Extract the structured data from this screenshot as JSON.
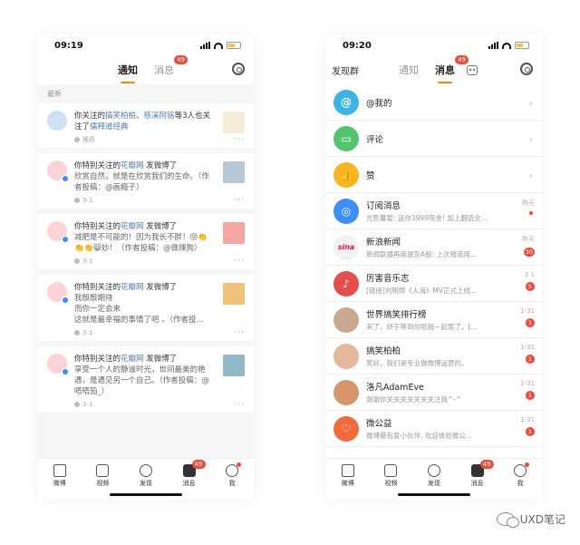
{
  "left": {
    "status_time": "09:19",
    "tabs": [
      {
        "label": "通知",
        "active": true
      },
      {
        "label": "消息",
        "badge": "49"
      }
    ],
    "section_label": "最新",
    "cards": [
      {
        "text_a": "你关注的",
        "link1": "搞笑柏柏",
        "sep": "、",
        "link2": "慈溪阿铭",
        "text_b": "等3人也关注了",
        "link3": "儒释道经典",
        "foot_icon": "person-icon",
        "foot_text": "推荐",
        "avatar_color": "#cfe0f5",
        "thumb_color": "#f3ecd6"
      },
      {
        "text_a": "你特别关注的",
        "link1": "花瓣网",
        "text_b": " 发微博了",
        "sub": "欣赏自然，就是在欣赏我们的生命。（作者投稿：@画瘾子）",
        "foot_text": "3-1",
        "avatar_color": "#fbd3d9",
        "thumb_color": "#b7c9d6"
      },
      {
        "text_a": "你特别关注的",
        "link1": "花瓣网",
        "text_b": " 发微博了",
        "sub": "减肥是不可能的！因为我长不胖！😝👏👏👏😸妙！（作者投稿：@微辣狗）",
        "foot_text": "3-1",
        "avatar_color": "#fbd3d9",
        "thumb_color": "#f4a7a0"
      },
      {
        "text_a": "你特别关注的",
        "link1": "花瓣网",
        "text_b": " 发微博了",
        "sub": "我殷殷期待\n而你一定会来\n这就是最幸福的事情了吧 。（作者投...",
        "foot_text": "3-1",
        "avatar_color": "#fbd3d9",
        "thumb_color": "#f0c27a"
      },
      {
        "text_a": "你特别关注的",
        "link1": "花瓣网",
        "text_b": " 发微博了",
        "sub": "享受一个人的静谧时光，世间最美的艳遇，是遇见另一个自己。（作者投稿：@嗒嗒笳_）",
        "foot_text": "3-1",
        "avatar_color": "#fbd3d9",
        "thumb_color": "#8fb9c9"
      }
    ],
    "tabbar": [
      {
        "label": "微博"
      },
      {
        "label": "视频"
      },
      {
        "label": "发现"
      },
      {
        "label": "消息",
        "badge": "49"
      },
      {
        "label": "我",
        "dot": true
      }
    ]
  },
  "right": {
    "status_time": "09:20",
    "left_link": "发现群",
    "tabs": [
      {
        "label": "通知"
      },
      {
        "label": "消息",
        "active": true,
        "badge": "49"
      }
    ],
    "messages": [
      {
        "title": "@我的",
        "preview": "",
        "time": "",
        "count": "",
        "chevron": true,
        "avatar_color": "#3ab5e6",
        "glyph": "@",
        "icon": "at-icon"
      },
      {
        "title": "评论",
        "preview": "",
        "time": "",
        "count": "",
        "chevron": true,
        "avatar_color": "#53c46c",
        "glyph": "▭",
        "icon": "comment-icon"
      },
      {
        "title": "赞",
        "preview": "",
        "time": "",
        "count": "",
        "chevron": true,
        "avatar_color": "#f8b51d",
        "glyph": "👍",
        "icon": "like-icon"
      },
      {
        "title": "订阅消息",
        "preview": "光影蔓婺: 送你3999现金! 加上翻选全...",
        "time": "昨天",
        "count": "",
        "dot": true,
        "avatar_color": "#3d8ef6",
        "glyph": "◎",
        "icon": "subscribe-icon"
      },
      {
        "title": "新浪新闻",
        "preview": "新闻联播再度提及A股: 上次报道用...",
        "time": "昨天",
        "count": "30",
        "avatar_color": "#f2f2f2",
        "glyph": "sina",
        "icon": "sina-logo"
      },
      {
        "title": "厉害音乐志",
        "preview": "[链接]刘明辉《人海》MV正式上线...",
        "time": "3-1",
        "count": "5",
        "avatar_color": "#e84d4d",
        "glyph": "♪",
        "icon": "music-avatar"
      },
      {
        "title": "世界搞笑排行榜",
        "preview": "来了。终于等到你陪我一起笑了。[...",
        "time": "1-31",
        "count": "1",
        "avatar_color": "#c7a98d",
        "glyph": "",
        "icon": "avatar"
      },
      {
        "title": "搞笑柏柏",
        "preview": "笑好。我们是专业做微博运营的。",
        "time": "1-31",
        "count": "1",
        "avatar_color": "#e4b79a",
        "glyph": "",
        "icon": "avatar"
      },
      {
        "title": "洛凡AdamEve",
        "preview": "谢谢你关关关关关关关注我^-^",
        "time": "1-31",
        "count": "1",
        "avatar_color": "#d7956a",
        "glyph": "",
        "icon": "avatar"
      },
      {
        "title": "微公益",
        "preview": "微博最有爱小伙伴, 欢迎体验微公...",
        "time": "1-31",
        "count": "1",
        "avatar_color": "#f06a3b",
        "glyph": "♡",
        "icon": "charity-icon"
      }
    ],
    "tabbar": [
      {
        "label": "微博"
      },
      {
        "label": "视频"
      },
      {
        "label": "发现"
      },
      {
        "label": "消息",
        "badge": "49"
      },
      {
        "label": "我",
        "dot": true
      }
    ]
  },
  "watermark": "UXD笔记",
  "colors": {
    "accent": "#ff8200",
    "badge": "#f04b38",
    "link": "#507daf"
  }
}
